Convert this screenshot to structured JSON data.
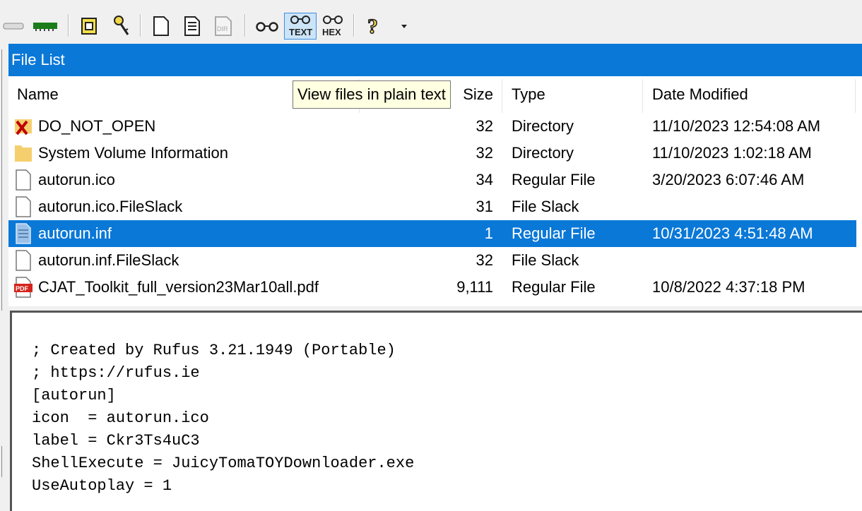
{
  "toolbar": {
    "buttons": [
      {
        "name": "disk-icon"
      },
      {
        "name": "memory-icon"
      },
      {
        "name": "open-evidence-icon"
      },
      {
        "name": "key-icon"
      },
      {
        "name": "new-file-icon"
      },
      {
        "name": "report-icon"
      },
      {
        "name": "dir-icon"
      },
      {
        "name": "view-glasses-icon"
      },
      {
        "name": "view-text-icon",
        "label": "TEXT"
      },
      {
        "name": "view-hex-icon",
        "label": "HEX"
      },
      {
        "name": "help-icon"
      }
    ],
    "dir_label": "DIR"
  },
  "file_list": {
    "title": "File List",
    "columns": {
      "name": "Name",
      "size": "Size",
      "type": "Type",
      "date": "Date Modified"
    },
    "rows": [
      {
        "name": "DO_NOT_OPEN",
        "size": "32",
        "type": "Directory",
        "date": "11/10/2023 12:54:08 AM",
        "icon": "deleted-folder"
      },
      {
        "name": "System Volume Information",
        "size": "32",
        "type": "Directory",
        "date": "11/10/2023 1:02:18 AM",
        "icon": "folder"
      },
      {
        "name": "autorun.ico",
        "size": "34",
        "type": "Regular File",
        "date": "3/20/2023 6:07:46 AM",
        "icon": "file"
      },
      {
        "name": "autorun.ico.FileSlack",
        "size": "31",
        "type": "File Slack",
        "date": "",
        "icon": "file"
      },
      {
        "name": "autorun.inf",
        "size": "1",
        "type": "Regular File",
        "date": "10/31/2023 4:51:48 AM",
        "icon": "inf-file",
        "selected": true
      },
      {
        "name": "autorun.inf.FileSlack",
        "size": "32",
        "type": "File Slack",
        "date": "",
        "icon": "file"
      },
      {
        "name": "CJAT_Toolkit_full_version23Mar10all.pdf",
        "size": "9,111",
        "type": "Regular File",
        "date": "10/8/2022 4:37:18 PM",
        "icon": "pdf"
      }
    ]
  },
  "tooltip": "View files in plain text",
  "viewer": {
    "lines": [
      "; Created by Rufus 3.21.1949 (Portable)",
      "; https://rufus.ie",
      "[autorun]",
      "icon  = autorun.ico",
      "label = Ckr3Ts4uC3",
      "ShellExecute = JuicyTomaTOYDownloader.exe",
      "UseAutoplay = 1"
    ]
  },
  "colors": {
    "accent": "#0a78d7",
    "tooltip_bg": "#ffffe1"
  }
}
